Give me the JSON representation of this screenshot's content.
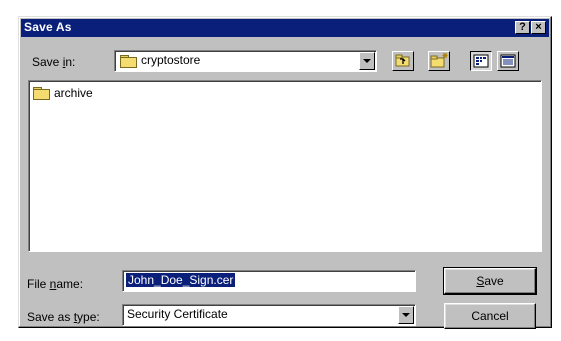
{
  "dialog": {
    "title": "Save As"
  },
  "titlebar_buttons": {
    "help": "?",
    "close": "×"
  },
  "save_in": {
    "label_prefix": "Save ",
    "label_hotkey": "i",
    "label_suffix": "n:",
    "value": "cryptostore"
  },
  "files": [
    {
      "name": "archive",
      "type": "folder"
    }
  ],
  "file_name": {
    "label_prefix": "File ",
    "label_hotkey": "n",
    "label_suffix": "ame:",
    "value": "John_Doe_Sign.cer"
  },
  "save_as_type": {
    "label_prefix": "Save as ",
    "label_hotkey": "t",
    "label_suffix": "ype:",
    "value": "Security Certificate"
  },
  "buttons": {
    "save_hotkey": "S",
    "save_rest": "ave",
    "cancel": "Cancel"
  },
  "colors": {
    "titlebar": "#0a1f7a",
    "face": "#c0c0c0",
    "selection": "#0a1f7a"
  }
}
